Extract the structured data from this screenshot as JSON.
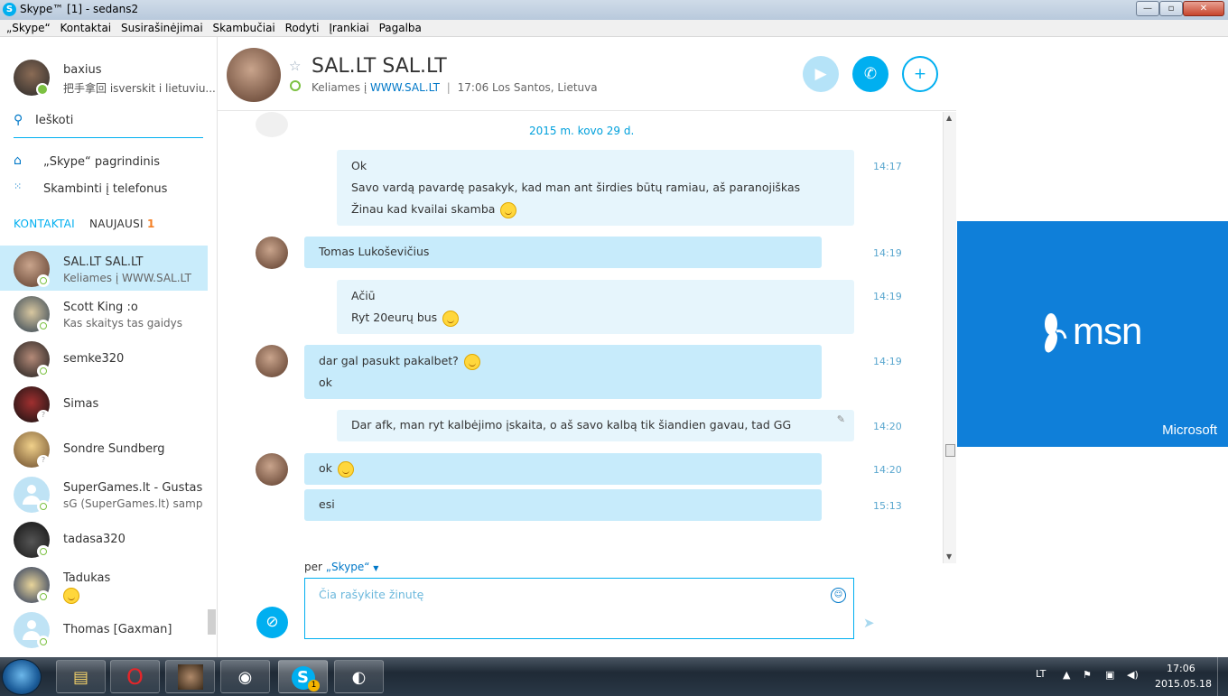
{
  "window": {
    "title": "Skype™ [1] - sedans2",
    "app_icon": "S"
  },
  "menu": [
    "„Skype“",
    "Kontaktai",
    "Susirašinėjimai",
    "Skambučiai",
    "Rodyti",
    "Įrankiai",
    "Pagalba"
  ],
  "me": {
    "name": "baxius",
    "mood": "把手拿回 isverskit i lietuviu..."
  },
  "search": {
    "label": "Ieškoti"
  },
  "nav": {
    "home": "„Skype“ pagrindinis",
    "call_phones": "Skambinti į telefonus"
  },
  "tabs": {
    "contacts": "KONTAKTAI",
    "recent": "NAUJAUSI",
    "recent_count": "1"
  },
  "contacts": [
    {
      "name": "SAL.LT SAL.LT",
      "mood": "Keliames į WWW.SAL.LT",
      "status": "online",
      "selected": true
    },
    {
      "name": "Scott King :o",
      "mood": "Kas skaitys tas gaidys",
      "status": "online"
    },
    {
      "name": "semke320",
      "mood": "",
      "status": "online"
    },
    {
      "name": "Simas",
      "mood": "",
      "status": "unknown"
    },
    {
      "name": "Sondre Sundberg",
      "mood": "",
      "status": "unknown"
    },
    {
      "name": "SuperGames.lt - Gustas...",
      "mood": "sG (SuperGames.lt) samp...",
      "status": "online"
    },
    {
      "name": "tadasa320",
      "mood": "",
      "status": "online"
    },
    {
      "name": "Tadukas",
      "mood": "",
      "status": "online",
      "mood_emoticon": true
    },
    {
      "name": "Thomas [Gaxman]",
      "mood": "",
      "status": "online"
    }
  ],
  "chat": {
    "name": "SAL.LT SAL.LT",
    "status_prefix": "Keliames į",
    "status_link": "WWW.SAL.LT",
    "separator": "|",
    "location": "17:06 Los Santos, Lietuva",
    "date": "2015 m. kovo 29 d.",
    "messages": [
      {
        "dir": "out",
        "time": "14:17",
        "lines": [
          "Ok",
          "Savo vardą pavardę pasakyk, kad man ant širdies būtų ramiau, aš paranojiškas",
          "Žinau kad kvailai skamba"
        ]
      },
      {
        "dir": "in",
        "time": "14:19",
        "lines": [
          "Tomas Lukoševičius"
        ]
      },
      {
        "dir": "out",
        "time": "14:19",
        "lines": [
          "Ačiū",
          "Ryt 20eurų bus"
        ]
      },
      {
        "dir": "in",
        "time": "14:19",
        "lines": [
          "dar gal pasukt pakalbet?",
          "ok"
        ]
      },
      {
        "dir": "out",
        "time": "14:20",
        "lines": [
          "Dar afk, man ryt kalbėjimo įskaita, o aš savo kalbą tik šiandien gavau, tad GG"
        ]
      },
      {
        "dir": "in",
        "time": "14:20",
        "lines": [
          "ok"
        ]
      },
      {
        "dir": "in",
        "time": "15:13",
        "lines": [
          "esi"
        ]
      }
    ]
  },
  "composer": {
    "via_prefix": "per",
    "via": "„Skype“",
    "placeholder": "Čia rašykite žinutę"
  },
  "ad": {
    "brand": "msn",
    "company": "Microsoft",
    "color": "#0f7fd9"
  },
  "taskbar": {
    "lang": "LT",
    "time": "17:06",
    "date": "2015.05.18",
    "skype_badge": "1"
  },
  "icons": [
    "search-icon",
    "home-icon",
    "dialpad-icon",
    "star-icon",
    "video-icon",
    "phone-icon",
    "add-contact-icon",
    "paperclip-icon",
    "emoticon-icon",
    "send-icon",
    "pencil-icon"
  ],
  "colors": {
    "accent": "#00aff0",
    "incoming_bubble": "#c7ebfb",
    "outgoing_bubble": "#e6f5fc",
    "online": "#7cc142",
    "badge": "#f58025"
  }
}
